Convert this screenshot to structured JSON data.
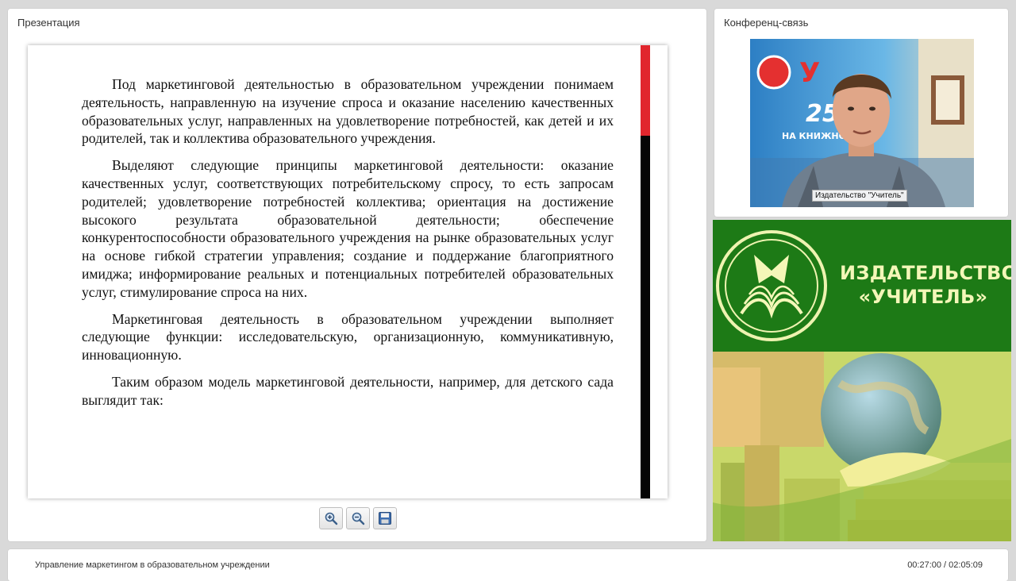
{
  "presentation": {
    "title": "Презентация",
    "slide": {
      "paragraphs": [
        "Под маркетинговой деятельностью в образовательном учреждении понимаем деятельность, направленную на изучение спроса и оказание населению качественных образовательных услуг, направленных на удовлетворение потребностей, как детей и их родителей, так и коллектива образовательного учреждения.",
        "Выделяют следующие принципы маркетинговой деятельности: оказание качественных услуг, соответствующих потребительскому спросу, то есть запросам родителей; удовлетворение потребностей коллектива; ориентация на достижение высокого результата образовательной деятельности; обеспечение конкурентоспособности образовательного учреждения на рынке образовательных услуг на основе гибкой стратегии управления; создание и поддержание благоприятного имиджа; информирование реальных и потенциальных потребителей образовательных услуг, стимулирование спроса на них.",
        "Маркетинговая деятельность в образовательном учреждении выполняет следующие функции: исследовательскую, организационную, коммуникативную, инновационную.",
        "Таким образом модель маркетинговой деятельности, например, для детского сада выглядит так:"
      ]
    },
    "toolbar": {
      "zoom_in_icon": "zoom-in-icon",
      "zoom_out_icon": "zoom-out-icon",
      "save_icon": "save-icon"
    }
  },
  "conference": {
    "title": "Конференц-связь",
    "video_label": "Издательство \"Учитель\"",
    "video_background_text": "25",
    "video_background_subtext": "НА КНИЖНО"
  },
  "banner": {
    "brand_line1": "ИЗДАТЕЛЬСТВО",
    "brand_line2": "«УЧИТЕЛЬ»"
  },
  "footer": {
    "course_title": "Управление маркетингом в образовательном учреждении",
    "time": "00:27:00 / 02:05:09"
  }
}
